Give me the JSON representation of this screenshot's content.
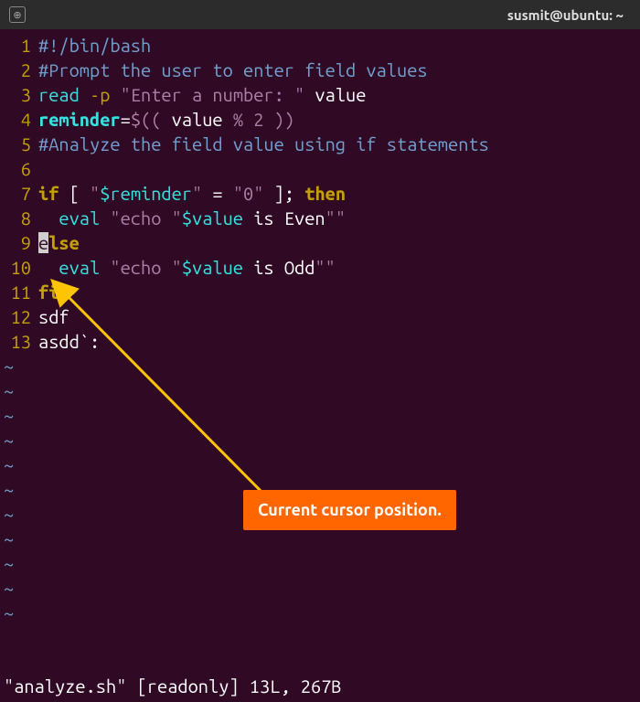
{
  "titlebar": {
    "title": "susmit@ubuntu: ~"
  },
  "lines": {
    "l1no": "1",
    "l2no": "2",
    "l3no": "3",
    "l4no": "4",
    "l5no": "5",
    "l6no": "6",
    "l7no": "7",
    "l8no": "8",
    "l9no": "9",
    "l10no": "10",
    "l11no": "11",
    "l12no": "12",
    "l13no": "13"
  },
  "code": {
    "l1_a": "#!/bin/bash",
    "l2_a": "#Prompt the user to enter field values",
    "l3_a": "read",
    "l3_b": " -p",
    "l3_c": " \"Enter a number: \"",
    "l3_d": " value",
    "l4_a": "reminder",
    "l4_b": "=",
    "l4_c": "$((",
    "l4_d": " value ",
    "l4_e": "%",
    "l4_f": " 2",
    "l4_g": " ))",
    "l5_a": "#Analyze the field value using if statements",
    "l7_a": "if",
    "l7_b": " [ ",
    "l7_c": "\"",
    "l7_d": "$reminder",
    "l7_e": "\"",
    "l7_f": " = ",
    "l7_g": "\"0\"",
    "l7_h": " ]; ",
    "l7_i": "then",
    "l8_a": "  eval ",
    "l8_b": "\"echo \"",
    "l8_c": "$value",
    "l8_d": " is Even",
    "l8_e": "\"\"",
    "l9_a": "e",
    "l9_b": "lse",
    "l10_a": "  eval ",
    "l10_b": "\"echo \"",
    "l10_c": "$value",
    "l10_d": " is Odd",
    "l10_e": "\"\"",
    "l11_a": "fi",
    "l12_a": "sdf",
    "l13_a": "asdd`:",
    "tilde": "~"
  },
  "status": {
    "text": "\"analyze.sh\" [readonly] 13L, 267B"
  },
  "annotation": {
    "label": "Current cursor position."
  }
}
